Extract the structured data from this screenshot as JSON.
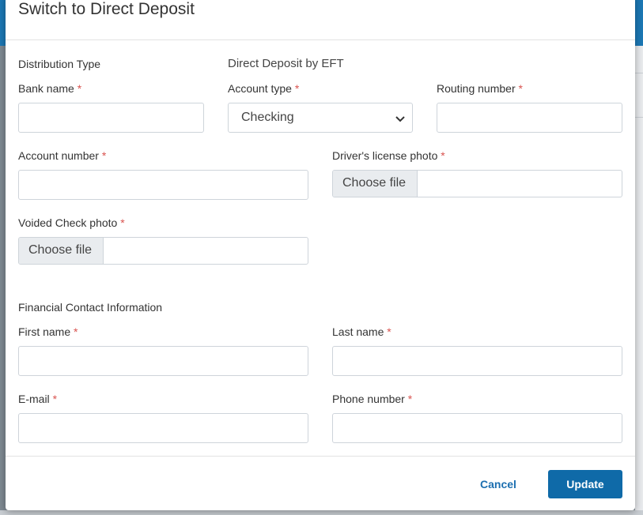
{
  "modal": {
    "title": "Switch to Direct Deposit",
    "distribution_type_label": "Distribution Type",
    "distribution_type_value": "Direct Deposit by EFT",
    "required_marker": "*",
    "fields": {
      "bank_name": {
        "label": "Bank name",
        "value": ""
      },
      "account_type": {
        "label": "Account type",
        "value": "Checking"
      },
      "routing_number": {
        "label": "Routing number",
        "value": ""
      },
      "account_number": {
        "label": "Account number",
        "value": ""
      },
      "drivers_license_photo": {
        "label": "Driver's license photo",
        "button": "Choose file"
      },
      "voided_check_photo": {
        "label": "Voided Check photo",
        "button": "Choose file"
      },
      "first_name": {
        "label": "First name",
        "value": ""
      },
      "last_name": {
        "label": "Last name",
        "value": ""
      },
      "email": {
        "label": "E-mail",
        "value": ""
      },
      "phone_number": {
        "label": "Phone number",
        "value": ""
      }
    },
    "financial_section_label": "Financial Contact Information",
    "footer": {
      "cancel_label": "Cancel",
      "update_label": "Update"
    }
  },
  "colors": {
    "primary": "#0f6aa8",
    "link": "#1c6fb0",
    "required": "#d9534f",
    "background_bar": "#1c78b5"
  }
}
